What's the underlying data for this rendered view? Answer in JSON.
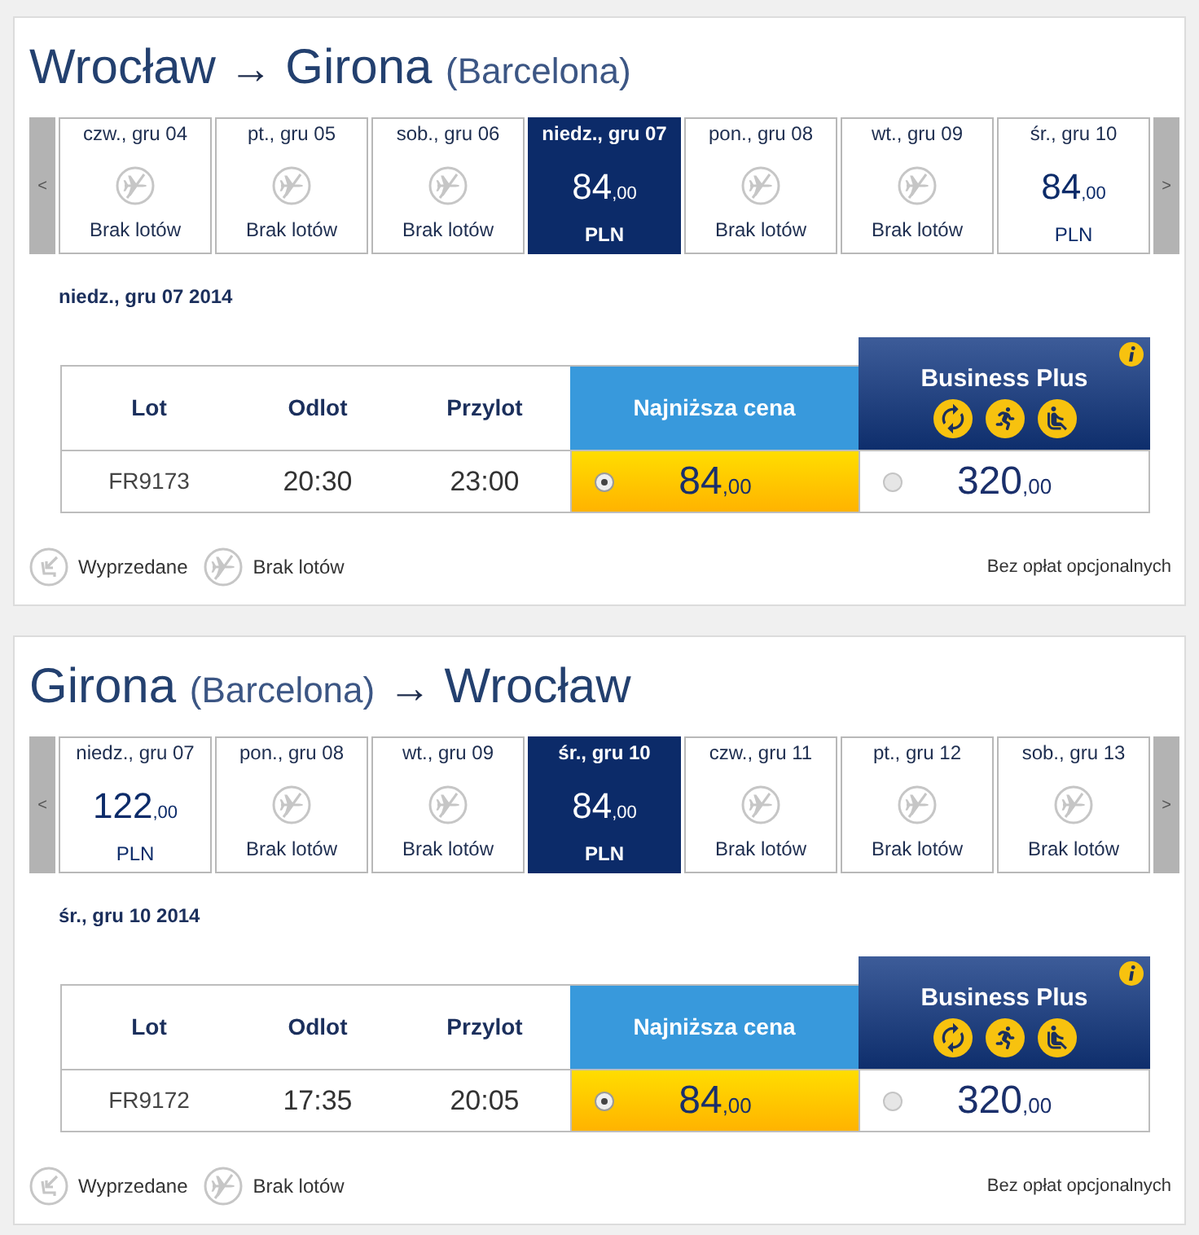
{
  "trips": [
    {
      "route": [
        {
          "kind": "city",
          "text": "Wrocław"
        },
        {
          "kind": "arrow",
          "text": "→"
        },
        {
          "kind": "city",
          "text": "Girona"
        },
        {
          "kind": "note",
          "text": "(Barcelona)"
        }
      ],
      "date_strip": {
        "prev": "<",
        "next": ">",
        "days": [
          {
            "date": "czw., gru 04",
            "selected": false,
            "kind": "none",
            "label": "Brak lotów"
          },
          {
            "date": "pt., gru 05",
            "selected": false,
            "kind": "none",
            "label": "Brak lotów"
          },
          {
            "date": "sob., gru 06",
            "selected": false,
            "kind": "none",
            "label": "Brak lotów"
          },
          {
            "date": "niedz., gru 07",
            "selected": true,
            "kind": "price",
            "price": "84",
            "decimals": ",00",
            "currency": "PLN"
          },
          {
            "date": "pon., gru 08",
            "selected": false,
            "kind": "none",
            "label": "Brak lotów"
          },
          {
            "date": "wt., gru 09",
            "selected": false,
            "kind": "none",
            "label": "Brak lotów"
          },
          {
            "date": "śr., gru 10",
            "selected": false,
            "kind": "price",
            "price": "84",
            "decimals": ",00",
            "currency": "PLN"
          }
        ]
      },
      "selected_date": "niedz., gru 07 2014",
      "table": {
        "columns": [
          "Lot",
          "Odlot",
          "Przylot"
        ],
        "fares": [
          {
            "kind": "standard",
            "name": "Najniższa cena"
          },
          {
            "kind": "business",
            "name": "Business Plus"
          }
        ],
        "rows": [
          {
            "flight": "FR9173",
            "departure": "20:30",
            "arrival": "23:00",
            "fares": [
              {
                "price": "84",
                "decimals": ",00",
                "selected": true
              },
              {
                "price": "320",
                "decimals": ",00",
                "selected": false
              }
            ]
          }
        ]
      },
      "legend": [
        {
          "kind": "sold_out",
          "label": "Wyprzedane"
        },
        {
          "kind": "none",
          "label": "Brak lotów"
        }
      ],
      "note": "Bez opłat opcjonalnych"
    },
    {
      "route": [
        {
          "kind": "city",
          "text": "Girona"
        },
        {
          "kind": "note",
          "text": "(Barcelona)"
        },
        {
          "kind": "arrow",
          "text": "→"
        },
        {
          "kind": "city",
          "text": "Wrocław"
        }
      ],
      "date_strip": {
        "prev": "<",
        "next": ">",
        "days": [
          {
            "date": "niedz., gru 07",
            "selected": false,
            "kind": "price",
            "price": "122",
            "decimals": ",00",
            "currency": "PLN"
          },
          {
            "date": "pon., gru 08",
            "selected": false,
            "kind": "none",
            "label": "Brak lotów"
          },
          {
            "date": "wt., gru 09",
            "selected": false,
            "kind": "none",
            "label": "Brak lotów"
          },
          {
            "date": "śr., gru 10",
            "selected": true,
            "kind": "price",
            "price": "84",
            "decimals": ",00",
            "currency": "PLN"
          },
          {
            "date": "czw., gru 11",
            "selected": false,
            "kind": "none",
            "label": "Brak lotów"
          },
          {
            "date": "pt., gru 12",
            "selected": false,
            "kind": "none",
            "label": "Brak lotów"
          },
          {
            "date": "sob., gru 13",
            "selected": false,
            "kind": "none",
            "label": "Brak lotów"
          }
        ]
      },
      "selected_date": "śr., gru 10 2014",
      "table": {
        "columns": [
          "Lot",
          "Odlot",
          "Przylot"
        ],
        "fares": [
          {
            "kind": "standard",
            "name": "Najniższa cena"
          },
          {
            "kind": "business",
            "name": "Business Plus"
          }
        ],
        "rows": [
          {
            "flight": "FR9172",
            "departure": "17:35",
            "arrival": "20:05",
            "fares": [
              {
                "price": "84",
                "decimals": ",00",
                "selected": true
              },
              {
                "price": "320",
                "decimals": ",00",
                "selected": false
              }
            ]
          }
        ]
      },
      "legend": [
        {
          "kind": "sold_out",
          "label": "Wyprzedane"
        },
        {
          "kind": "none",
          "label": "Brak lotów"
        }
      ],
      "note": "Bez opłat opcjonalnych"
    }
  ]
}
